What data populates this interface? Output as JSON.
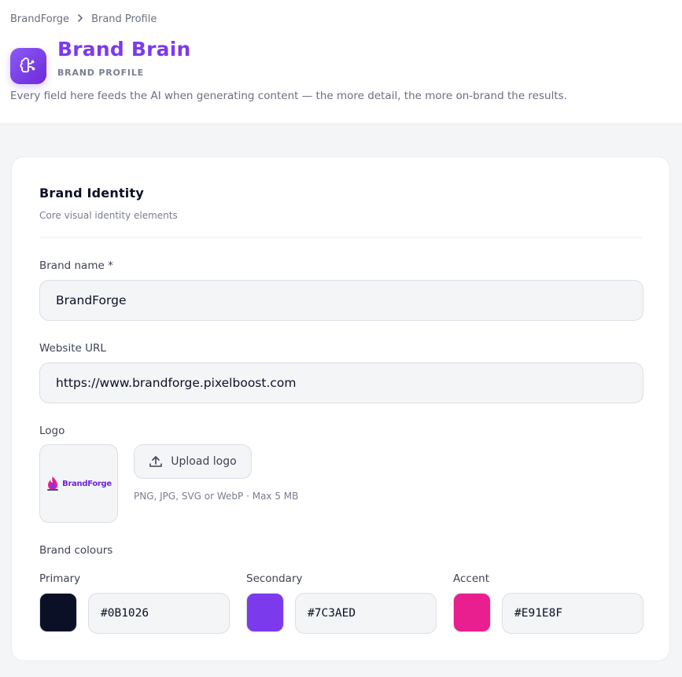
{
  "breadcrumb": {
    "root": "BrandForge",
    "current": "Brand Profile"
  },
  "header": {
    "title": "Brand Brain",
    "subtitle": "BRAND PROFILE",
    "description": "Every field here feeds the AI when generating content — the more detail, the more on-brand the results.",
    "icon": "brain-icon"
  },
  "identity": {
    "title": "Brand Identity",
    "subtitle": "Core visual identity elements",
    "brand_name_label": "Brand name *",
    "brand_name_value": "BrandForge",
    "website_label": "Website URL",
    "website_value": "https://www.brandforge.pixelboost.com",
    "logo_label": "Logo",
    "logo_text": "BrandForge",
    "upload_label": "Upload logo",
    "upload_hint": "PNG, JPG, SVG or WebP · Max 5 MB",
    "colours_label": "Brand colours",
    "colours": [
      {
        "label": "Primary",
        "value": "#0B1026",
        "swatch": "#0b1026"
      },
      {
        "label": "Secondary",
        "value": "#7C3AED",
        "swatch": "#7c3aed"
      },
      {
        "label": "Accent",
        "value": "#E91E8F",
        "swatch": "#e91e8f"
      }
    ]
  }
}
